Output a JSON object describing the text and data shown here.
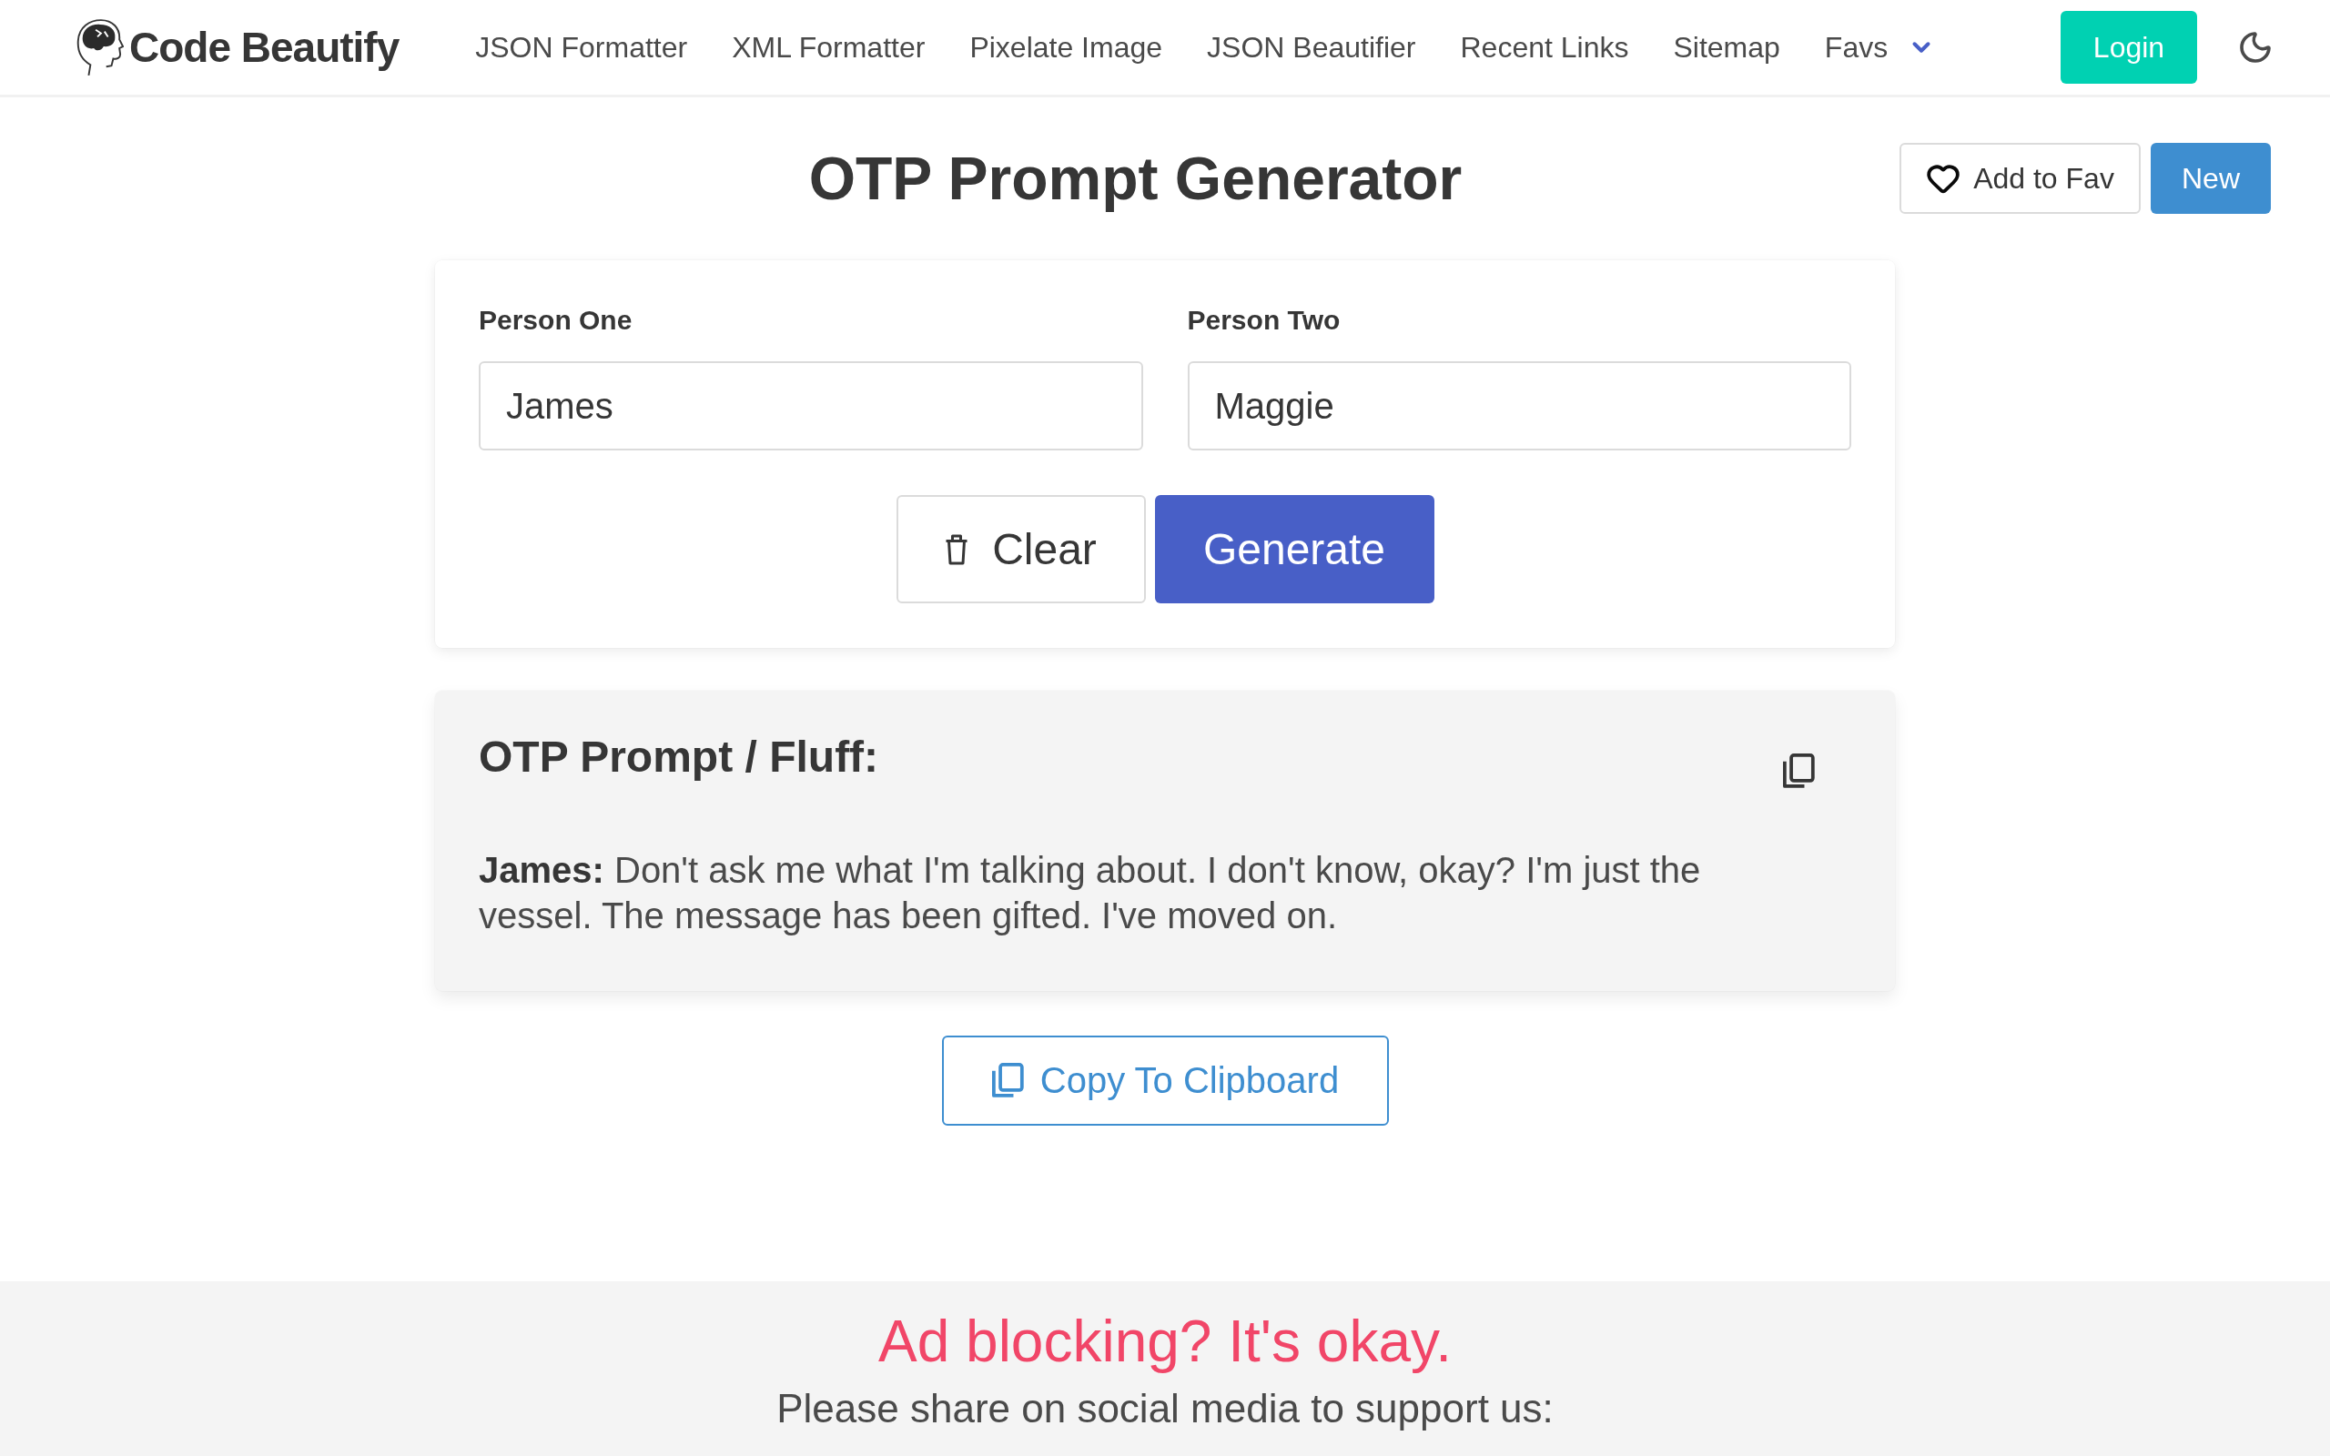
{
  "header": {
    "logo": "Code Beautify",
    "nav": [
      {
        "label": "JSON Formatter",
        "kind": "link"
      },
      {
        "label": "XML Formatter",
        "kind": "link"
      },
      {
        "label": "Pixelate Image",
        "kind": "link"
      },
      {
        "label": "JSON Beautifier",
        "kind": "link"
      },
      {
        "label": "Recent Links",
        "kind": "link"
      },
      {
        "label": "Sitemap",
        "kind": "link"
      },
      {
        "label": "Favs",
        "kind": "dropdown"
      }
    ],
    "login": "Login"
  },
  "title_bar": {
    "title": "OTP Prompt Generator",
    "add_to_fav": "Add to Fav",
    "new": "New"
  },
  "form": {
    "fields": [
      {
        "label": "Person One",
        "value": "James"
      },
      {
        "label": "Person Two",
        "value": "Maggie"
      }
    ],
    "clear": "Clear",
    "generate": "Generate"
  },
  "result": {
    "title": "OTP Prompt / Fluff:",
    "text": "**James:** Don't ask me what I'm talking about. I don't know, okay? I'm just the vessel. The message has been gifted. I've moved on."
  },
  "copy_button": "Copy To Clipboard",
  "footer": {
    "heading": "Ad blocking? It's okay.",
    "text": "Please share on social media to support us:"
  }
}
